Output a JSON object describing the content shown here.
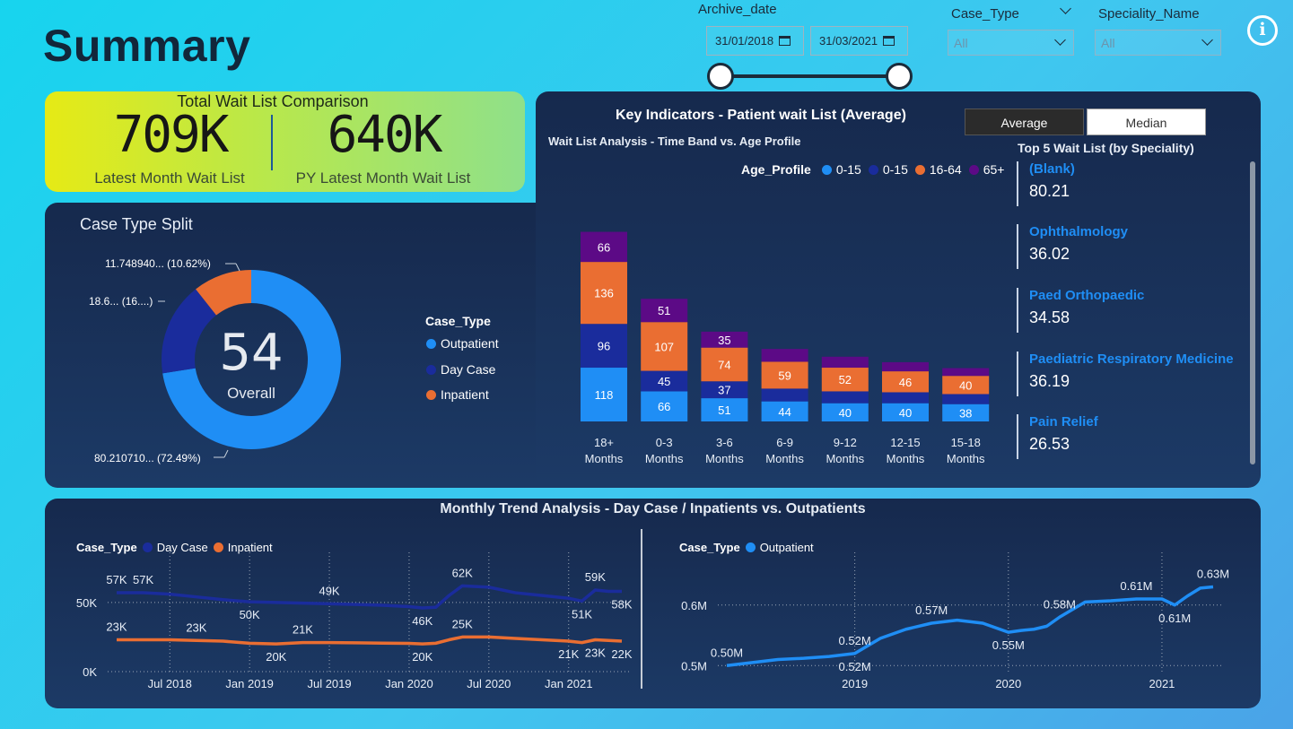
{
  "page": {
    "title": "Summary"
  },
  "slicers": {
    "archive_date": {
      "label": "Archive_date",
      "start": "31/01/2018",
      "end": "31/03/2021"
    },
    "case_type": {
      "label": "Case_Type",
      "value": "All"
    },
    "speciality": {
      "label": "Speciality_Name",
      "value": "All"
    }
  },
  "info_icon": "i",
  "total": {
    "title": "Total Wait List Comparison",
    "latest_value": "709K",
    "latest_label": "Latest Month Wait List",
    "py_value": "640K",
    "py_label": "PY Latest Month Wait List"
  },
  "colors": {
    "outpatient": "#1f8ef5",
    "daycase": "#1a2c9c",
    "inpatient": "#ea6e32",
    "age65": "#5c0a86"
  },
  "case_split": {
    "title": "Case Type Split",
    "center_value": "54",
    "center_label": "Overall",
    "labels": {
      "inpatient": "11.748940... (10.62%)",
      "daycase": "18.6... (16....)",
      "outpatient": "80.210710... (72.49%)"
    },
    "legend_title": "Case_Type",
    "legend": [
      "Outpatient",
      "Day Case",
      "Inpatient"
    ],
    "chart_data": {
      "type": "pie",
      "categories": [
        "Outpatient",
        "Day Case",
        "Inpatient"
      ],
      "values": [
        80.21071,
        18.6,
        11.74894
      ],
      "percent": [
        72.49,
        16.0,
        10.62
      ]
    }
  },
  "key_indicators": {
    "title": "Key Indicators - Patient wait List (Average)",
    "toggle_average": "Average",
    "toggle_median": "Median",
    "chart_title": "Wait List Analysis - Time Band vs. Age Profile",
    "legend_title": "Age_Profile",
    "legend": [
      "0-15",
      "0-15",
      "16-64",
      "65+"
    ],
    "chart_data": {
      "type": "bar",
      "categories": [
        [
          "18+",
          "Months"
        ],
        [
          "0-3",
          "Months"
        ],
        [
          "3-6",
          "Months"
        ],
        [
          "6-9",
          "Months"
        ],
        [
          "9-12",
          "Months"
        ],
        [
          "12-15",
          "Months"
        ],
        [
          "15-18",
          "Months"
        ]
      ],
      "series": [
        {
          "name": "0-15",
          "values": [
            118,
            66,
            51,
            44,
            40,
            40,
            38
          ]
        },
        {
          "name": "0-15",
          "values": [
            96,
            45,
            37,
            28,
            26,
            24,
            22
          ]
        },
        {
          "name": "16-64",
          "values": [
            136,
            107,
            74,
            59,
            52,
            46,
            40
          ]
        },
        {
          "name": "65+",
          "values": [
            66,
            51,
            35,
            28,
            24,
            20,
            17
          ]
        }
      ],
      "hidden_labels": [
        [
          false,
          false,
          false,
          false
        ],
        [
          false,
          false,
          false,
          false
        ],
        [
          false,
          false,
          false,
          false
        ],
        [
          false,
          true,
          false,
          true
        ],
        [
          false,
          true,
          false,
          true
        ],
        [
          false,
          true,
          false,
          true
        ],
        [
          false,
          true,
          false,
          true
        ]
      ]
    }
  },
  "top5": {
    "title": "Top 5 Wait List (by Speciality)",
    "items": [
      {
        "name": "(Blank)",
        "value": "80.21"
      },
      {
        "name": "Ophthalmology",
        "value": "36.02"
      },
      {
        "name": "Paed Orthopaedic",
        "value": "34.58"
      },
      {
        "name": "Paediatric Respiratory Medicine",
        "value": "36.19"
      },
      {
        "name": "Pain Relief",
        "value": "26.53"
      }
    ]
  },
  "monthly": {
    "title": "Monthly Trend Analysis - Day Case / Inpatients vs. Outpatients",
    "left": {
      "legend_title": "Case_Type",
      "legend": [
        "Day Case",
        "Inpatient"
      ],
      "chart_data": {
        "type": "line",
        "x": [
          "2018-03",
          "2018-05",
          "2018-07",
          "2018-09",
          "2018-11",
          "2019-01",
          "2019-03",
          "2019-05",
          "2019-07",
          "2019-09",
          "2019-11",
          "2020-01",
          "2020-02",
          "2020-03",
          "2020-04",
          "2020-05",
          "2020-07",
          "2020-09",
          "2020-11",
          "2021-01",
          "2021-02",
          "2021-03",
          "2021-04",
          "2021-05"
        ],
        "series": [
          {
            "name": "Day Case",
            "values": [
              57,
              57,
              56,
              54,
              52,
              50.5,
              50,
              49.5,
              49,
              48.5,
              48,
              47,
              46,
              46.5,
              55,
              62,
              61,
              57,
              55,
              53,
              51,
              59,
              58,
              58
            ]
          },
          {
            "name": "Inpatient",
            "values": [
              23,
              23,
              23,
              22.5,
              22,
              20.5,
              20,
              21,
              21,
              20.8,
              20.6,
              20.4,
              20,
              20.5,
              23,
              25,
              25,
              24,
              23,
              22,
              21,
              23,
              22.5,
              22
            ]
          }
        ],
        "ylim": [
          0,
          70
        ],
        "yticks": [
          {
            "v": 0,
            "label": "0K"
          },
          {
            "v": 50,
            "label": "50K"
          }
        ],
        "xticks": [
          {
            "x": "2018-07",
            "label": "Jul 2018"
          },
          {
            "x": "2019-01",
            "label": "Jan 2019"
          },
          {
            "x": "2019-07",
            "label": "Jul 2019"
          },
          {
            "x": "2020-01",
            "label": "Jan 2020"
          },
          {
            "x": "2020-07",
            "label": "Jul 2020"
          },
          {
            "x": "2021-01",
            "label": "Jan 2021"
          }
        ],
        "data_labels": [
          {
            "series": 0,
            "i": 0,
            "label": "57K",
            "pos": "above"
          },
          {
            "series": 0,
            "i": 1,
            "label": "57K",
            "pos": "above"
          },
          {
            "series": 0,
            "i": 5,
            "label": "50K",
            "pos": "below"
          },
          {
            "series": 0,
            "i": 8,
            "label": "49K",
            "pos": "above"
          },
          {
            "series": 0,
            "i": 12,
            "label": "46K",
            "pos": "below"
          },
          {
            "series": 0,
            "i": 15,
            "label": "62K",
            "pos": "above"
          },
          {
            "series": 0,
            "i": 20,
            "label": "51K",
            "pos": "below"
          },
          {
            "series": 0,
            "i": 21,
            "label": "59K",
            "pos": "above"
          },
          {
            "series": 0,
            "i": 23,
            "label": "58K",
            "pos": "below"
          },
          {
            "series": 1,
            "i": 0,
            "label": "23K",
            "pos": "above"
          },
          {
            "series": 1,
            "i": 3,
            "label": "23K",
            "pos": "above"
          },
          {
            "series": 1,
            "i": 6,
            "label": "20K",
            "pos": "below"
          },
          {
            "series": 1,
            "i": 7,
            "label": "21K",
            "pos": "above"
          },
          {
            "series": 1,
            "i": 12,
            "label": "20K",
            "pos": "below"
          },
          {
            "series": 1,
            "i": 15,
            "label": "25K",
            "pos": "above"
          },
          {
            "series": 1,
            "i": 19,
            "label": "21K",
            "pos": "below"
          },
          {
            "series": 1,
            "i": 21,
            "label": "23K",
            "pos": "below"
          },
          {
            "series": 1,
            "i": 23,
            "label": "22K",
            "pos": "below"
          }
        ]
      }
    },
    "right": {
      "legend_title": "Case_Type",
      "legend": [
        "Outpatient"
      ],
      "chart_data": {
        "type": "line",
        "x": [
          "2018-03",
          "2018-05",
          "2018-07",
          "2018-09",
          "2018-11",
          "2019-01",
          "2019-03",
          "2019-05",
          "2019-07",
          "2019-09",
          "2019-11",
          "2020-01",
          "2020-02",
          "2020-03",
          "2020-04",
          "2020-05",
          "2020-07",
          "2020-09",
          "2020-11",
          "2021-01",
          "2021-02",
          "2021-03",
          "2021-04",
          "2021-05"
        ],
        "series": [
          {
            "name": "Outpatient",
            "values": [
              0.5,
              0.505,
              0.51,
              0.512,
              0.515,
              0.52,
              0.545,
              0.56,
              0.57,
              0.575,
              0.57,
              0.555,
              0.558,
              0.56,
              0.565,
              0.58,
              0.605,
              0.607,
              0.61,
              0.61,
              0.6,
              0.615,
              0.628,
              0.63
            ]
          }
        ],
        "ylim": [
          0.49,
          0.65
        ],
        "yticks": [
          {
            "v": 0.5,
            "label": "0.5M"
          },
          {
            "v": 0.6,
            "label": "0.6M"
          }
        ],
        "xticks": [
          {
            "x": "2019-01",
            "label": "2019"
          },
          {
            "x": "2020-01",
            "label": "2020"
          },
          {
            "x": "2021-01",
            "label": "2021"
          }
        ],
        "data_labels": [
          {
            "series": 0,
            "i": 0,
            "label": "0.50M",
            "pos": "above"
          },
          {
            "series": 0,
            "i": 5,
            "label": "0.52M",
            "pos": "above"
          },
          {
            "series": 0,
            "i": 5,
            "label": "0.52M",
            "pos": "below"
          },
          {
            "series": 0,
            "i": 8,
            "label": "0.57M",
            "pos": "above"
          },
          {
            "series": 0,
            "i": 11,
            "label": "0.55M",
            "pos": "below"
          },
          {
            "series": 0,
            "i": 15,
            "label": "0.58M",
            "pos": "above"
          },
          {
            "series": 0,
            "i": 18,
            "label": "0.61M",
            "pos": "above"
          },
          {
            "series": 0,
            "i": 20,
            "label": "0.61M",
            "pos": "below"
          },
          {
            "series": 0,
            "i": 23,
            "label": "0.63M",
            "pos": "above"
          }
        ]
      }
    }
  }
}
